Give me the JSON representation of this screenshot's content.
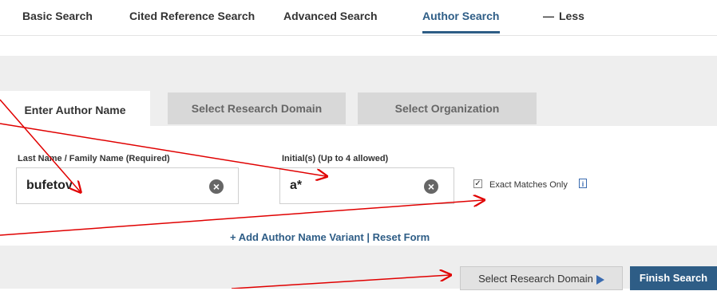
{
  "topnav": {
    "basic": "Basic Search",
    "cited": "Cited Reference Search",
    "advanced": "Advanced Search",
    "author": "Author Search",
    "less": "Less"
  },
  "tabs": {
    "enter_author": "Enter Author Name",
    "research_domain": "Select Research Domain",
    "organization": "Select Organization"
  },
  "form": {
    "last_name_label": "Last Name / Family Name  (Required)",
    "last_name_value": "bufetov",
    "initials_label": "Initial(s)  (Up to 4 allowed)",
    "initials_value": "a*",
    "exact_label": "Exact Matches Only",
    "exact_checked": true,
    "info_glyph": "i"
  },
  "links": {
    "add_variant": "+ Add Author Name Variant",
    "separator": "|",
    "reset": "Reset Form"
  },
  "buttons": {
    "select_domain": "Select Research Domain",
    "finish": "Finish Search"
  },
  "colors": {
    "accent": "#2e5d86",
    "annotation_arrow": "#e00000"
  }
}
